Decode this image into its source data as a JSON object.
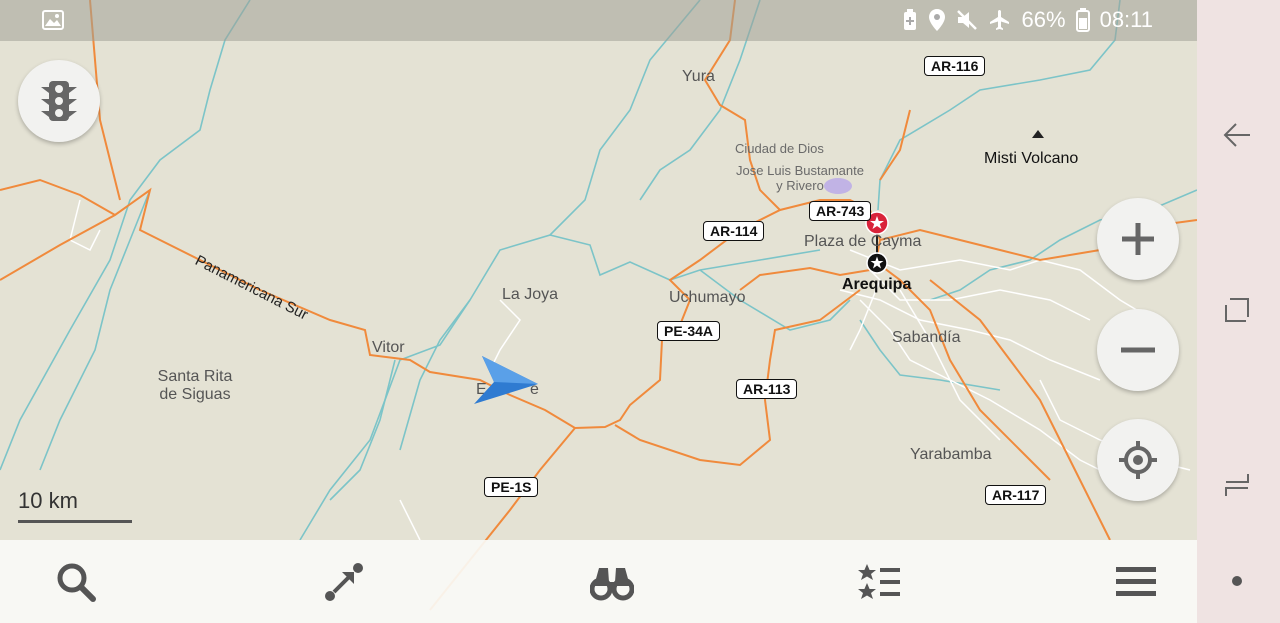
{
  "status_bar": {
    "battery_percent": "66%",
    "time": "08:11",
    "icons": [
      "image-icon",
      "battery-saver-icon",
      "location-icon",
      "mute-icon",
      "airplane-icon",
      "battery-icon"
    ]
  },
  "map": {
    "places": [
      {
        "name": "Yura"
      },
      {
        "name": "Ciudad de Dios"
      },
      {
        "name": "Jose Luis Bustamante y Rivero"
      },
      {
        "name": "Misti Volcano"
      },
      {
        "name": "Plaza de Cayma"
      },
      {
        "name": "Arequipa"
      },
      {
        "name": "La Joya"
      },
      {
        "name": "Uchumayo"
      },
      {
        "name": "Vitor"
      },
      {
        "name": "Sabandía"
      },
      {
        "name": "Santa Rita de Siguas"
      },
      {
        "name": "Yarabamba"
      }
    ],
    "road_shields": [
      "AR-116",
      "AR-743",
      "AR-114",
      "PE-34A",
      "AR-113",
      "PE-1S",
      "AR-117"
    ],
    "road_name": "Panamericana Sur",
    "partial_label": "E",
    "partial_label_end": "e",
    "scale": "10 km",
    "colors": {
      "land": "#e4e2d4",
      "primary_road": "#f08a3c",
      "river": "#7cc4c8",
      "marker": "#d9233a",
      "arrow": "#2f7bd1"
    }
  },
  "controls": {
    "traffic": "traffic-light-icon",
    "zoom_in": "plus-icon",
    "zoom_out": "minus-icon",
    "locate": "locate-icon"
  },
  "bottom_nav": [
    "search-icon",
    "route-icon",
    "binoculars-icon",
    "bookmarks-icon",
    "menu-icon"
  ],
  "system_nav": [
    "back-icon",
    "recents-icon",
    "switch-icon",
    "dot-icon"
  ]
}
